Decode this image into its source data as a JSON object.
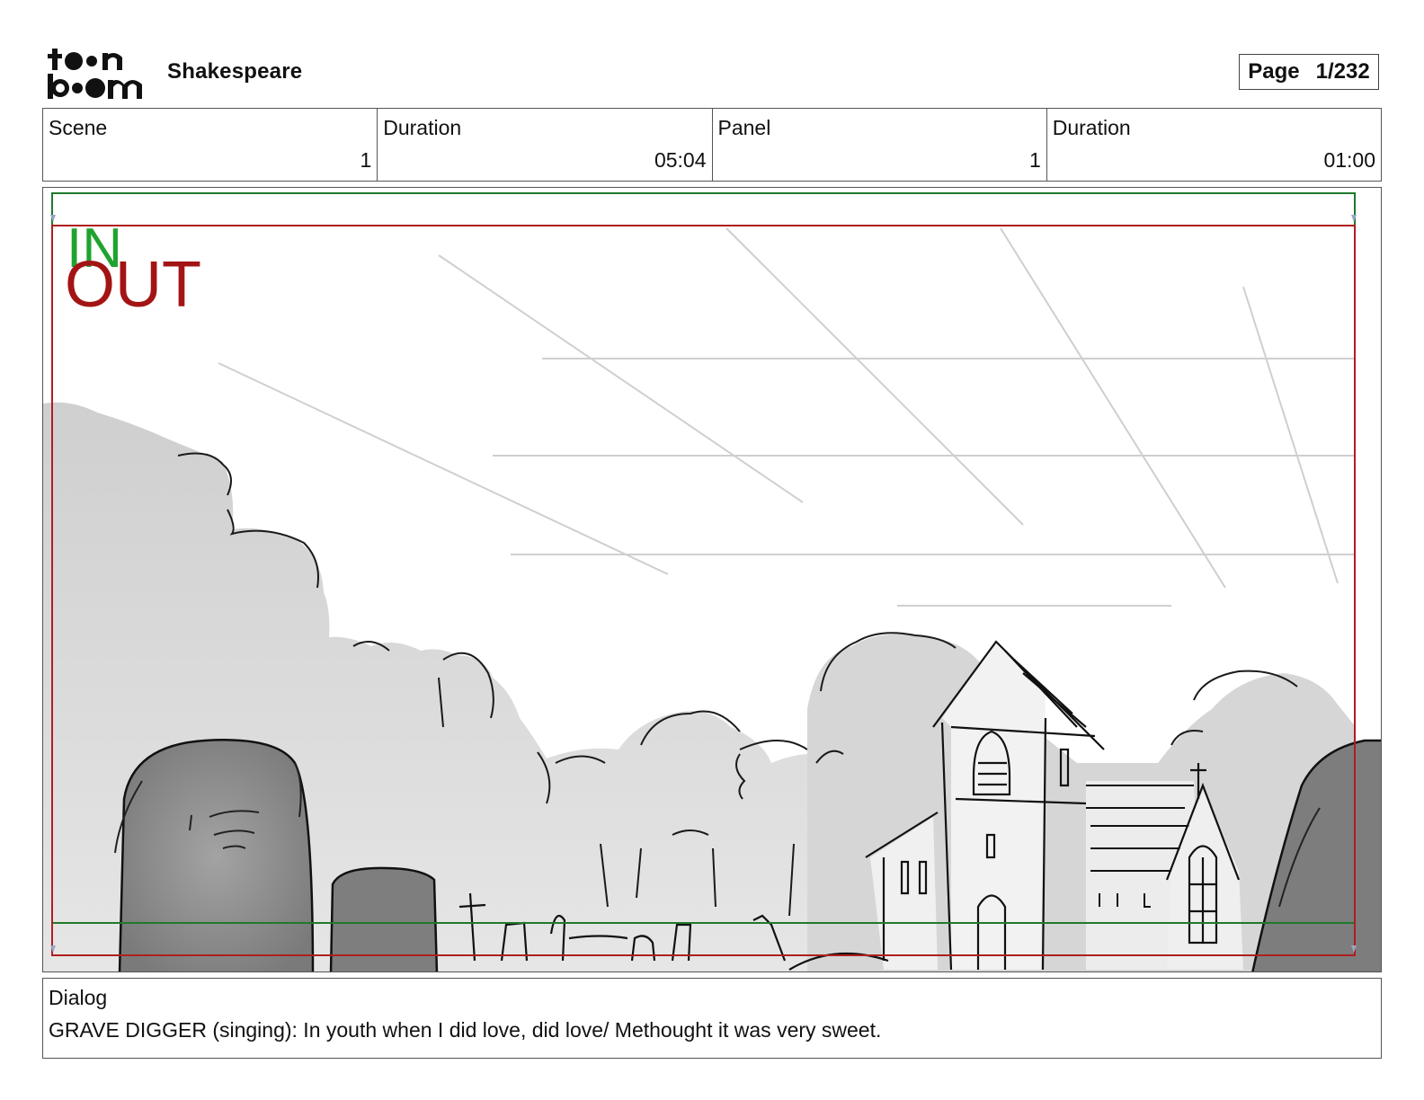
{
  "header": {
    "logo_text_top": "toon",
    "logo_text_bottom": "boom",
    "project_title": "Shakespeare",
    "page_label": "Page",
    "page_value": "1/232"
  },
  "info": {
    "scene_label": "Scene",
    "scene_value": "1",
    "scene_duration_label": "Duration",
    "scene_duration_value": "05:04",
    "panel_label": "Panel",
    "panel_value": "1",
    "panel_duration_label": "Duration",
    "panel_duration_value": "01:00"
  },
  "panel": {
    "in_marker": "IN",
    "out_marker": "OUT",
    "colors": {
      "in_frame": "#1e7a2c",
      "out_frame": "#b01e1e",
      "in_text": "#1fa32e",
      "out_text": "#a31414"
    }
  },
  "dialog": {
    "label": "Dialog",
    "text": "GRAVE DIGGER (singing): In youth when I did love, did love/ Methought it was very sweet."
  }
}
